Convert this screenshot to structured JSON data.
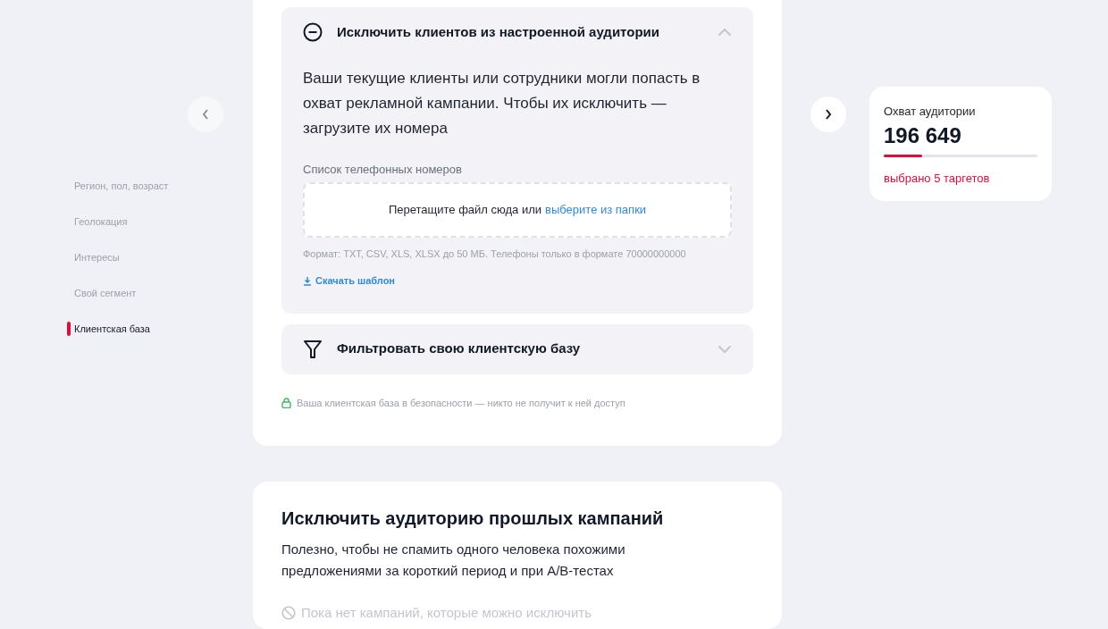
{
  "nav": {
    "items": [
      {
        "label": "Регион, пол, возраст",
        "selected": false
      },
      {
        "label": "Геолокация",
        "selected": false
      },
      {
        "label": "Интересы",
        "selected": false
      },
      {
        "label": "Свой сегмент",
        "selected": false
      },
      {
        "label": "Клиентская база",
        "selected": true
      }
    ]
  },
  "accordions": [
    {
      "kind": "exclude",
      "title": "Исключить клиентов из настроенной аудитории",
      "expanded": true,
      "description": "Ваши текущие клиенты или сотрудники могли попасть в охват рекламной кампании. Чтобы их исключить — загрузите их номера",
      "upload": {
        "label": "Список телефонных номеров",
        "prompt": "Перетащите файл сюда или",
        "link": "выберите из папки",
        "hint": "Формат: TXT, CSV, XLS, XLSX до 50 МБ. Телефоны только в формате 70000000000",
        "download": "Скачать шаблон"
      }
    },
    {
      "kind": "filter",
      "title": "Фильтровать свою клиентскую базу",
      "expanded": false
    }
  ],
  "security_note": "Ваша клиентская база в безопасности — никто не получит к ней доступ",
  "past_campaigns": {
    "title": "Исключить аудиторию прошлых кампаний",
    "description": "Полезно, чтобы не спамить одного человека похожими предложениями за короткий период и при A/B-тестах",
    "empty": "Пока нет кампаний, которые можно исключить"
  },
  "reach": {
    "title": "Охват аудитории",
    "value": "196 649",
    "level": 0.25,
    "targets": "выбрано 5 таргетов"
  }
}
